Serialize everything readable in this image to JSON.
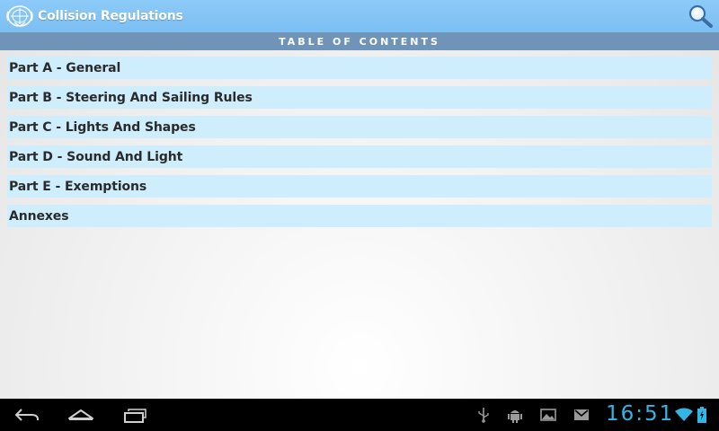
{
  "action_bar": {
    "title": "Collision Regulations",
    "logo_icon": "imo-emblem-icon",
    "search_icon": "search-icon"
  },
  "section_header": {
    "label": "TABLE OF CONTENTS"
  },
  "toc": {
    "items": [
      {
        "label": "Part A - General"
      },
      {
        "label": "Part B - Steering And Sailing Rules"
      },
      {
        "label": "Part C - Lights And Shapes"
      },
      {
        "label": "Part D - Sound And Light"
      },
      {
        "label": "Part E - Exemptions"
      },
      {
        "label": "Annexes"
      }
    ]
  },
  "system_bar": {
    "clock": "16:51",
    "nav_icons": [
      "back-icon",
      "home-icon",
      "recent-apps-icon"
    ],
    "status_icons": [
      "usb-icon",
      "android-debug-icon",
      "gallery-icon",
      "gmail-icon",
      "wifi-icon",
      "battery-icon"
    ]
  },
  "colors": {
    "action_bar": "#7cbff2",
    "section_header": "#7094b8",
    "list_item": "#cfeefd",
    "clock": "#31b6e7"
  }
}
